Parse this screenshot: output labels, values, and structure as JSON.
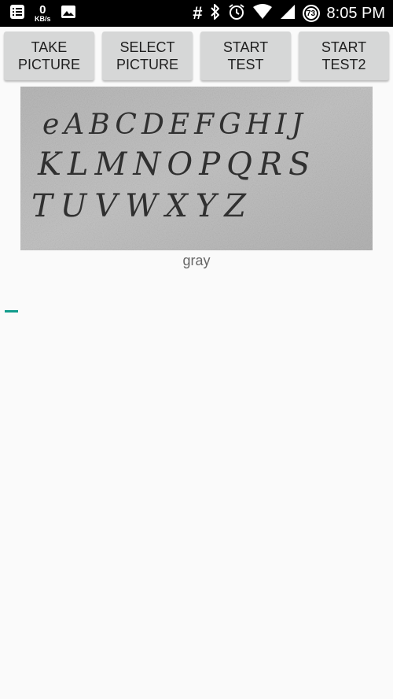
{
  "status_bar": {
    "network_speed_value": "0",
    "network_speed_unit": "KB/s",
    "hash_symbol": "#",
    "battery_level": "73",
    "time": "8:05 PM",
    "icons": [
      "notes-icon",
      "image-icon",
      "bluetooth-icon",
      "alarm-icon",
      "wifi-icon",
      "signal-icon",
      "battery-icon"
    ]
  },
  "toolbar": {
    "take_picture_line1": "TAKE",
    "take_picture_line2": "PICTURE",
    "select_picture_line1": "SELECT",
    "select_picture_line2": "PICTURE",
    "start_test_line1": "START",
    "start_test_line2": "TEST",
    "start_test2_line1": "START",
    "start_test2_line2": "TEST2"
  },
  "image": {
    "handwritten_lines": [
      "eABCDEFGHIJ",
      "KLMNOPQRS",
      "TUVWXYZ"
    ]
  },
  "caption": "gray",
  "colors": {
    "background": "#fafafa",
    "button": "#d6d7d7",
    "accent": "#129c8c",
    "status_bar": "#000000"
  }
}
